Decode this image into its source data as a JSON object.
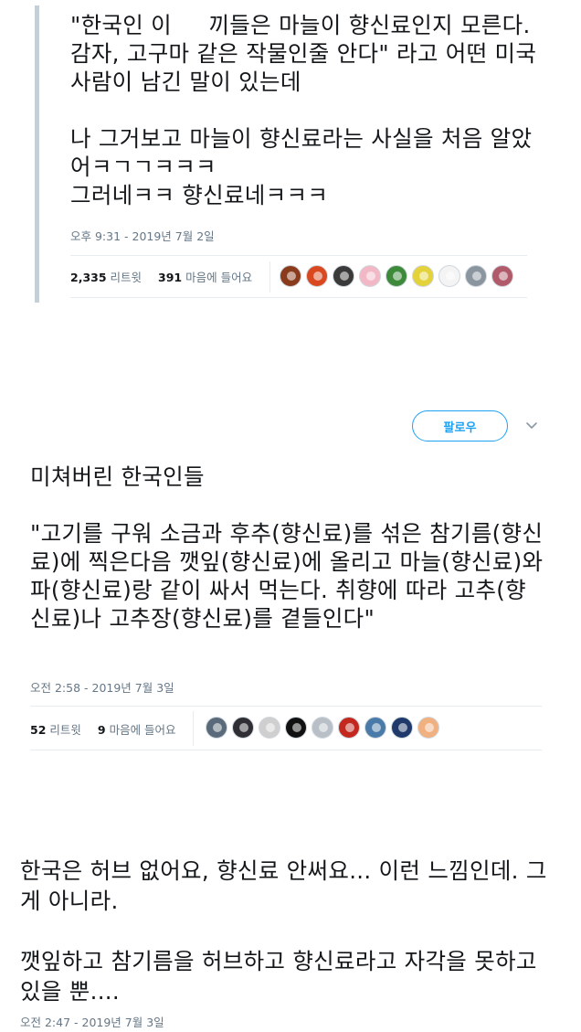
{
  "tweet1": {
    "text": "\"한국인 이     끼들은 마늘이 향신료인지 모른다. 감자, 고구마 같은 작물인줄 안다\" 라고 어떤 미국 사람이 남긴 말이 있는데\n\n나 그거보고 마늘이 향신료라는 사실을 처음 알았어ㅋㄱㄱㅋㅋㅋ\n그러네ㅋㅋ 향신료네ㅋㅋㅋ",
    "timestamp": "오후 9:31 - 2019년 7월 2일",
    "retweet_count": "2,335",
    "retweet_label": "리트윗",
    "like_count": "391",
    "like_label": "마음에 들어요",
    "avatar_colors": [
      "#8a3b1c",
      "#d9481f",
      "#3a3a3a",
      "#f2b8c6",
      "#3d8a3a",
      "#e3d23a",
      "#f4f4f4",
      "#8b95a0",
      "#b05a6a"
    ]
  },
  "tweet2": {
    "follow_label": "팔로우",
    "text": "미쳐버린 한국인들\n\n\"고기를 구워 소금과 후추(향신료)를 섞은 참기름(향신료)에 찍은다음 깻잎(향신료)에 올리고 마늘(향신료)와 파(향신료)랑 같이 싸서 먹는다. 취향에 따라 고추(향신료)나 고추장(향신료)를 곁들인다\"",
    "timestamp": "오전 2:58 - 2019년 7월 3일",
    "retweet_count": "52",
    "retweet_label": "리트윗",
    "like_count": "9",
    "like_label": "마음에 들어요",
    "avatar_colors": [
      "#5a6a7a",
      "#2e2e34",
      "#cfcfcf",
      "#111111",
      "#b8bfc6",
      "#c2281e",
      "#4a7aa8",
      "#1f3a6a",
      "#f0b080"
    ]
  },
  "tweet3": {
    "text": "한국은 허브 없어요, 향신료 안써요... 이런 느낌인데. 그게 아니라.\n\n깻잎하고 참기름을 허브하고 향신료라고 자각을 못하고 있을 뿐....",
    "timestamp": "오전 2:47 - 2019년 7월 3일"
  },
  "colors": {
    "accent": "#1da1f2",
    "meta_text": "#657786",
    "divider": "#e6ecf0",
    "quote_bar": "#c4cfd6"
  }
}
